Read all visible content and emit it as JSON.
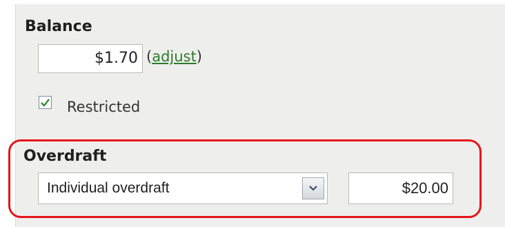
{
  "balance": {
    "title": "Balance",
    "value": "$1.70",
    "adjust_open": "(",
    "adjust_label": "adjust",
    "adjust_close": ")"
  },
  "restricted": {
    "label": "Restricted",
    "checked": true
  },
  "overdraft": {
    "title": "Overdraft",
    "type_selected": "Individual overdraft",
    "amount": "$20.00"
  },
  "colors": {
    "highlight": "#e5141a",
    "link": "#2b7a2a",
    "check": "#2f8a2f"
  }
}
